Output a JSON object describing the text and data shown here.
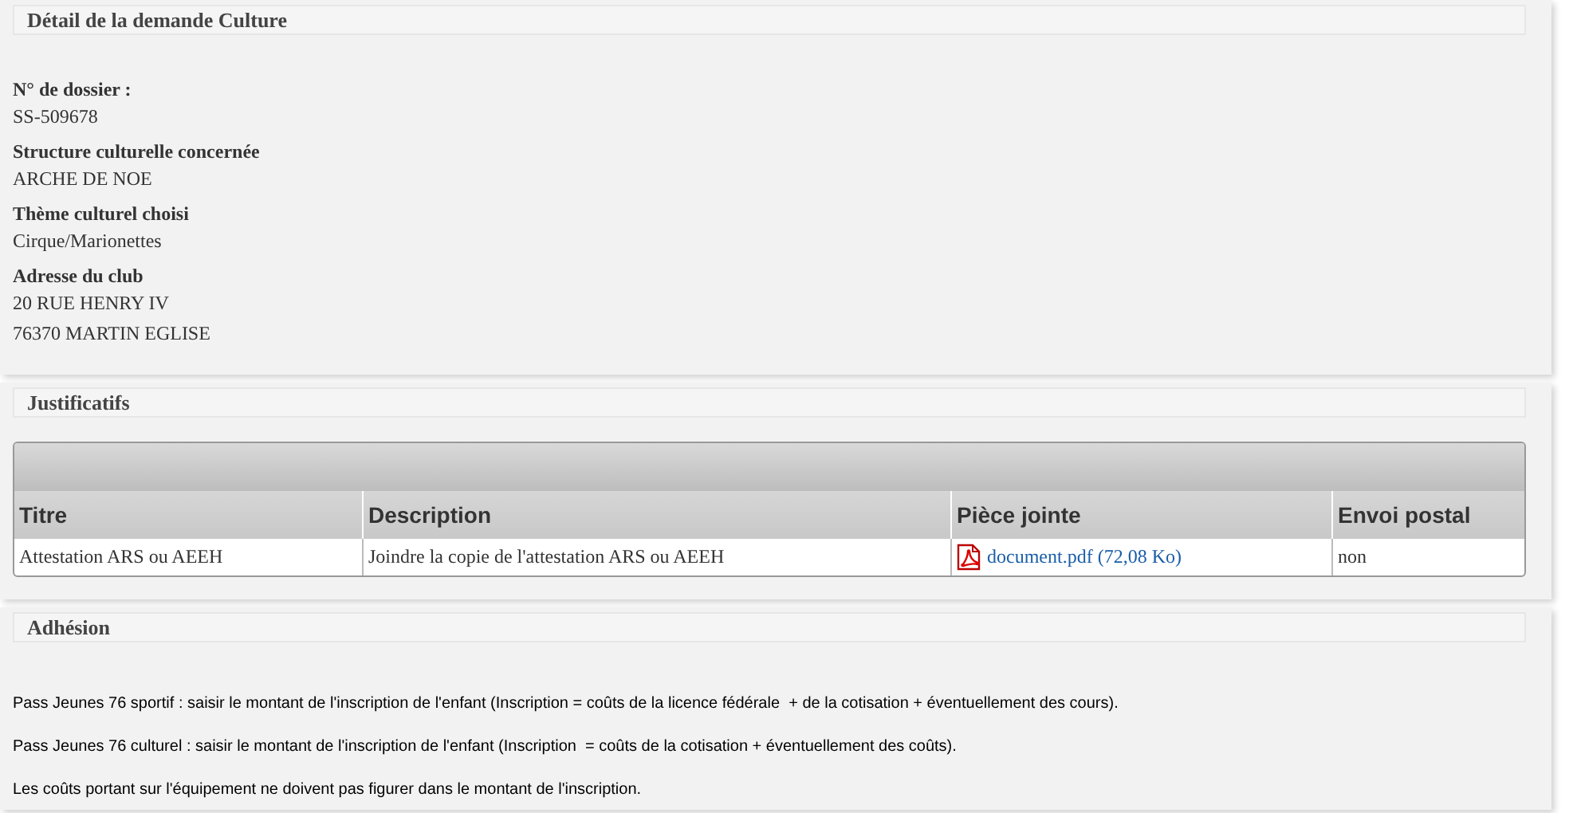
{
  "sections": [
    {
      "title": "Détail de la demande Culture",
      "kind": "fields",
      "fields": [
        {
          "label": "N° de dossier :",
          "values": [
            "SS-509678"
          ]
        },
        {
          "label": "Structure culturelle concernée",
          "values": [
            "ARCHE DE NOE"
          ]
        },
        {
          "label": "Thème culturel choisi",
          "values": [
            "Cirque/Marionettes"
          ]
        },
        {
          "label": "Adresse du club",
          "values": [
            "20 RUE HENRY IV",
            "76370 MARTIN EGLISE"
          ]
        }
      ]
    },
    {
      "title": "Justificatifs",
      "kind": "table",
      "table": {
        "columns": [
          "Titre",
          "Description",
          "Pièce jointe",
          "Envoi postal"
        ],
        "rows": [
          {
            "titre": "Attestation ARS ou AEEH",
            "description": "Joindre la copie de l'attestation ARS ou AEEH",
            "attachment": "document.pdf (72,08 Ko)",
            "postal": "non"
          }
        ]
      }
    },
    {
      "title": "Adhésion",
      "kind": "text",
      "paragraphs": [
        "Pass Jeunes 76 sportif : saisir le montant de l'inscription de l'enfant (Inscription = coûts de la licence fédérale  + de la cotisation + éventuellement des cours).",
        "Pass Jeunes 76 culturel : saisir le montant de l'inscription de l'enfant (Inscription  = coûts de la cotisation + éventuellement des coûts).",
        "Les coûts portant sur l'équipement ne doivent pas figurer dans le montant de l'inscription."
      ]
    }
  ]
}
